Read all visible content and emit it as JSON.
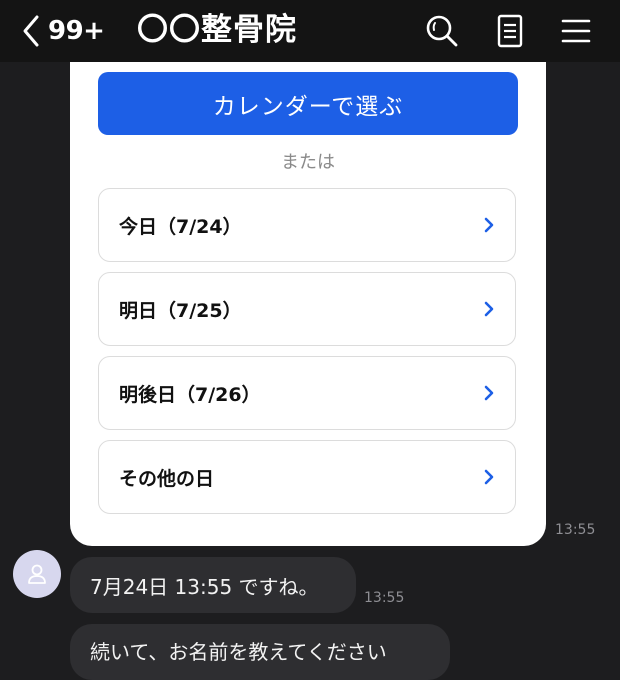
{
  "header": {
    "back_count": "99+",
    "title": "〇〇整骨院"
  },
  "card": {
    "calendar_button": "カレンダーで選ぶ",
    "or_text": "または",
    "options": [
      {
        "label": "今日（7/24）"
      },
      {
        "label": "明日（7/25）"
      },
      {
        "label": "明後日（7/26）"
      },
      {
        "label": "その他の日"
      }
    ],
    "time": "13:55"
  },
  "messages": [
    {
      "text": "7月24日 13:55 ですね。",
      "time": "13:55"
    },
    {
      "text": "続いて、お名前を教えてください"
    }
  ],
  "colors": {
    "accent": "#1d5fe6",
    "background": "#1d1d1f",
    "header": "#141414",
    "bubble": "#2e2e31",
    "avatar": "#d7d7ee"
  },
  "icons": {
    "back": "chevron-left-icon",
    "search": "search-icon",
    "notes": "notes-icon",
    "menu": "menu-icon",
    "option": "chevron-right-icon",
    "avatar": "person-icon"
  }
}
